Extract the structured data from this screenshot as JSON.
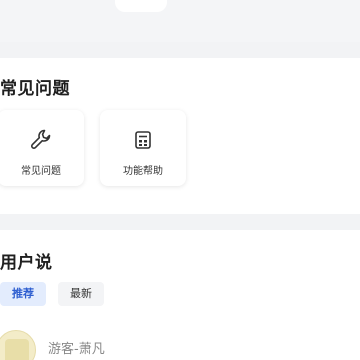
{
  "faq_section": {
    "title": "常见问题",
    "cards": [
      {
        "label": "常见问题",
        "icon": "wrench-icon"
      },
      {
        "label": "功能帮助",
        "icon": "calculator-icon"
      }
    ]
  },
  "user_section": {
    "title": "用户说",
    "tabs": [
      {
        "label": "推荐",
        "active": true
      },
      {
        "label": "最新",
        "active": false
      }
    ],
    "comments": [
      {
        "username": "游客-萧凡"
      }
    ]
  },
  "colors": {
    "accent": "#2f5fd0",
    "accent_bg": "#e3ecfd"
  }
}
